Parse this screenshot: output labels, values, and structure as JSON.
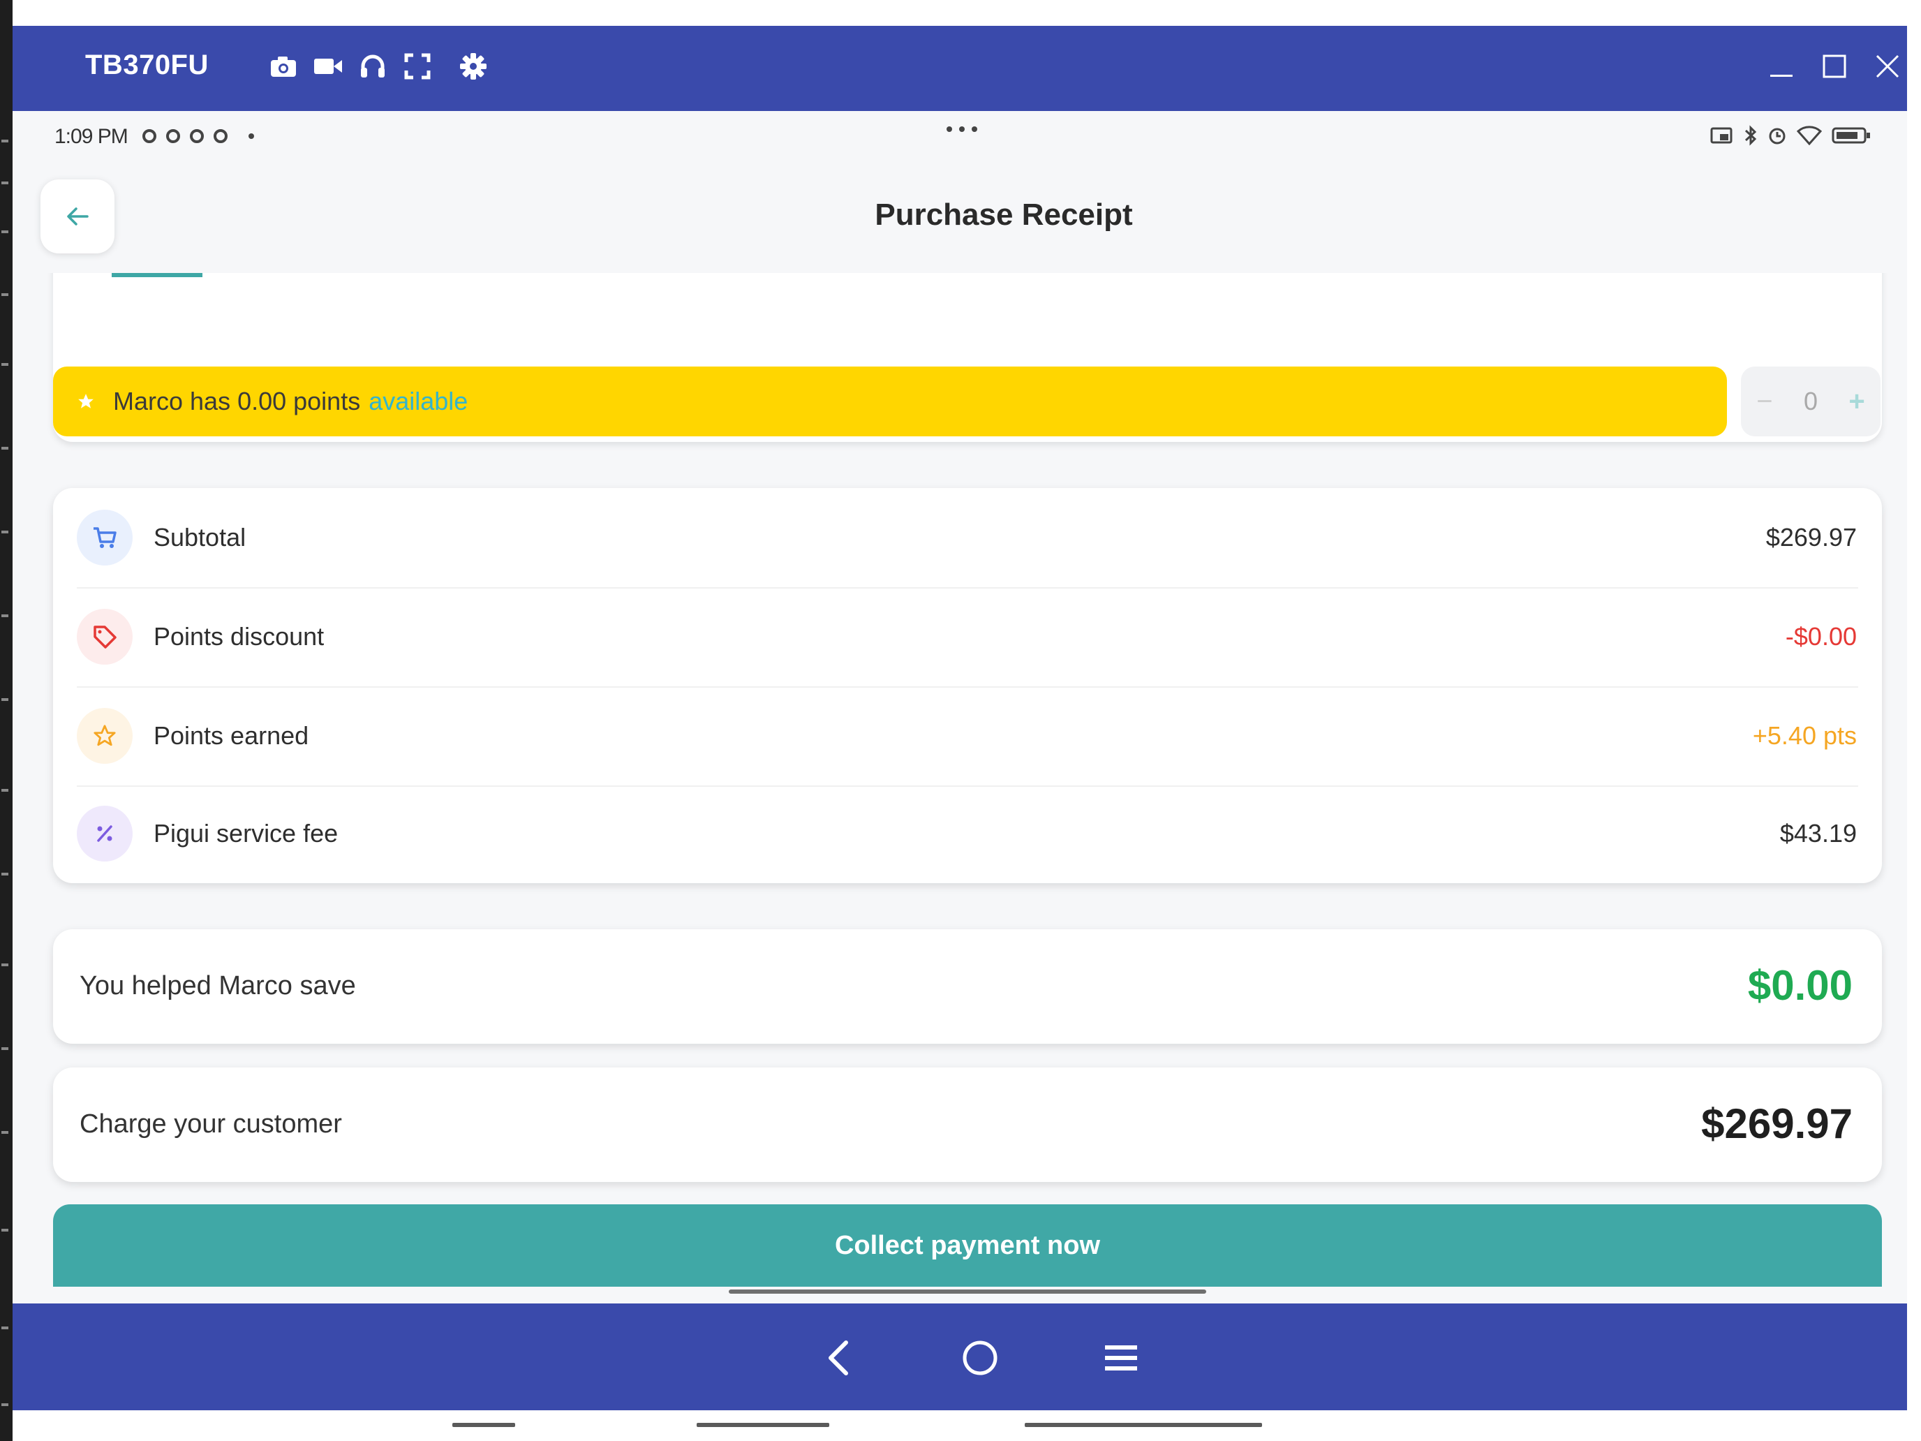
{
  "window": {
    "device_name": "TB370FU",
    "toolbar_icons": [
      "camera-icon",
      "video-icon",
      "headphones-icon",
      "fullscreen-icon",
      "settings-gear-icon"
    ],
    "window_controls": [
      "minimize-icon",
      "maximize-icon",
      "close-icon"
    ]
  },
  "status_bar": {
    "time": "1:09 PM",
    "right_icons": [
      "cast-icon",
      "bluetooth-icon",
      "alarm-icon",
      "wifi-icon",
      "battery-icon"
    ]
  },
  "header": {
    "title": "Purchase Receipt",
    "back_icon": "arrow-left-icon"
  },
  "points_banner": {
    "text": "Marco has 0.00 points",
    "highlight": "available",
    "stepper": {
      "minus": "−",
      "value": "0",
      "plus": "+"
    }
  },
  "breakdown": {
    "rows": [
      {
        "label": "Subtotal",
        "amount": "$269.97",
        "icon": "cart-icon",
        "color": "#2e2e2e"
      },
      {
        "label": "Points discount",
        "amount": "-$0.00",
        "icon": "tag-icon",
        "color": "#e53935"
      },
      {
        "label": "Points earned",
        "amount": "+5.40 pts",
        "icon": "star-icon",
        "color": "#f5a623"
      },
      {
        "label": "Pigui service fee",
        "amount": "$43.19",
        "icon": "percent-icon",
        "color": "#2e2e2e"
      }
    ]
  },
  "savings": {
    "label": "You helped Marco save",
    "amount": "$0.00"
  },
  "charge": {
    "label": "Charge your customer",
    "amount": "$269.97"
  },
  "actions": {
    "collect_label": "Collect payment now"
  },
  "nav": {
    "icons": [
      "back-nav-icon",
      "home-nav-icon",
      "recents-nav-icon"
    ]
  },
  "colors": {
    "frame": "#3a4aab",
    "accent_teal": "#40a8a6",
    "banner_yellow": "#ffd600",
    "savings_green": "#1faa52",
    "discount_red": "#e53935",
    "points_orange": "#f5a623"
  }
}
